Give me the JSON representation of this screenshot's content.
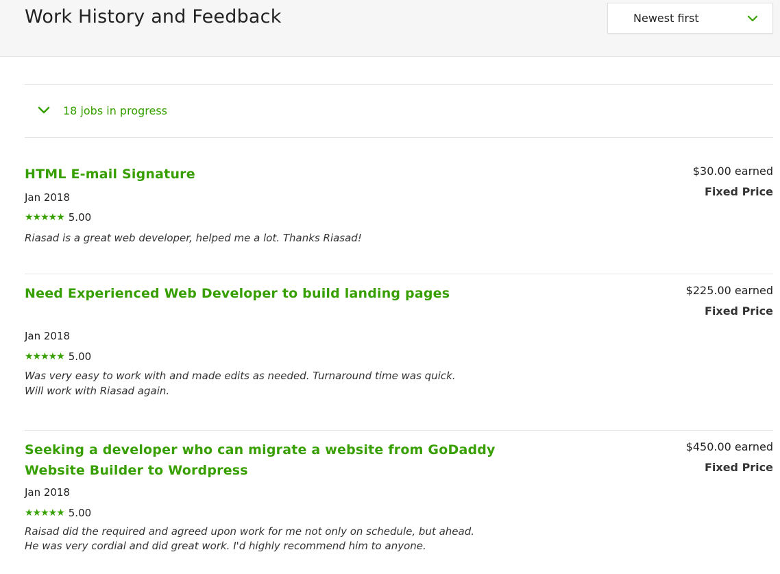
{
  "header": {
    "title": "Work History and Feedback",
    "sort": {
      "selected": "Newest first"
    }
  },
  "in_progress": {
    "label": "18 jobs in progress"
  },
  "jobs": [
    {
      "title": "HTML E-mail Signature",
      "date": "Jan 2018",
      "stars": "★★★★★",
      "rating": "5.00",
      "feedback": "Riasad is a great web developer, helped me a lot. Thanks Riasad!",
      "earned": "$30.00 earned",
      "type": "Fixed Price"
    },
    {
      "title": "Need Experienced Web Developer to build landing pages",
      "date": "Jan 2018",
      "stars": "★★★★★",
      "rating": "5.00",
      "feedback": "Was very easy to work with and made edits as needed. Turnaround time was quick. Will work with Riasad again.",
      "earned": "$225.00 earned",
      "type": "Fixed Price"
    },
    {
      "title": "Seeking a developer who can migrate a website from GoDaddy Website Builder to Wordpress",
      "date": "Jan 2018",
      "stars": "★★★★★",
      "rating": "5.00",
      "feedback": "Raisad did the required and agreed upon work for me not only on schedule, but ahead. He was very cordial and did great work. I'd highly recommend him to anyone.",
      "earned": "$450.00 earned",
      "type": "Fixed Price"
    }
  ],
  "colors": {
    "accent": "#37a000",
    "text": "#222222",
    "header_bg": "#f6f6f6",
    "divider": "#e4e4e4"
  },
  "icons": {
    "sort_chevron": "chevron-down-icon",
    "toggle_chevron": "chevron-down-icon",
    "star": "star-icon"
  }
}
